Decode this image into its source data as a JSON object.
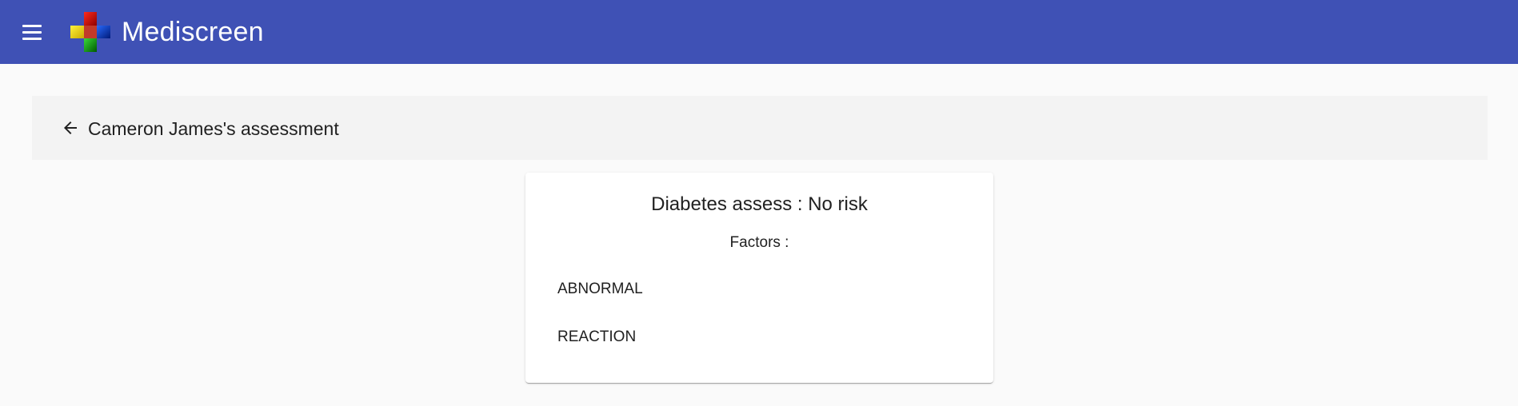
{
  "toolbar": {
    "brand": "Mediscreen",
    "menu_icon": "menu-icon",
    "logo_icon": "medical-cross-logo",
    "background": "#3f51b5"
  },
  "header": {
    "back_icon": "arrow-back-icon",
    "title": "Cameron James's assessment"
  },
  "assessment": {
    "title": "Diabetes assess : No risk",
    "factors_label": "Factors :",
    "factors": [
      "ABNORMAL",
      "REACTION"
    ]
  }
}
